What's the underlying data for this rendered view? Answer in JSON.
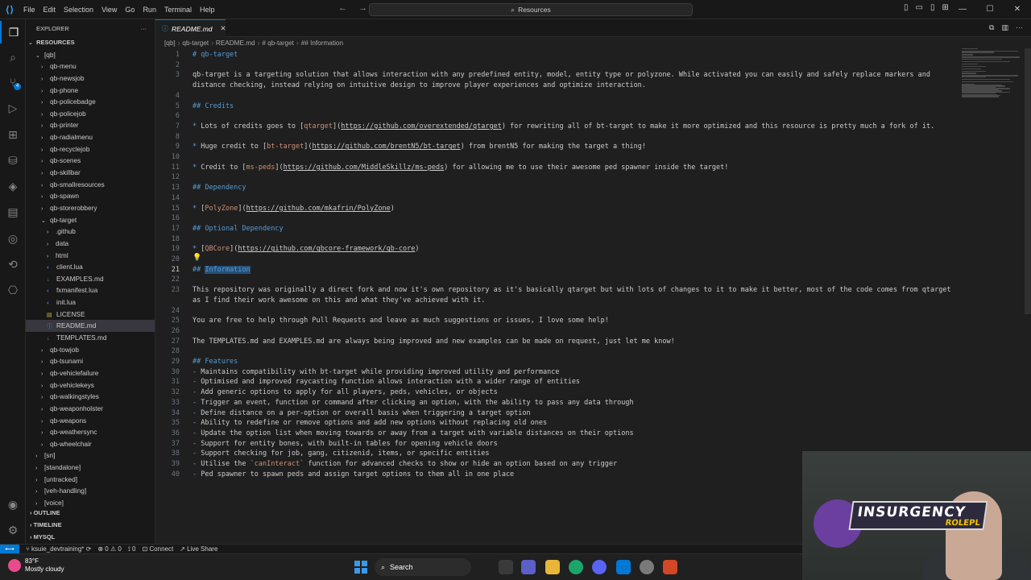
{
  "titlebar": {
    "menu": [
      "File",
      "Edit",
      "Selection",
      "View",
      "Go",
      "Run",
      "Terminal",
      "Help"
    ],
    "search_text": "Resources"
  },
  "sidebar": {
    "title": "EXPLORER",
    "root": "RESOURCES",
    "items": [
      {
        "label": "[qb]",
        "depth": 1,
        "type": "folder-open"
      },
      {
        "label": "qb-menu",
        "depth": 2,
        "type": "folder"
      },
      {
        "label": "qb-newsjob",
        "depth": 2,
        "type": "folder"
      },
      {
        "label": "qb-phone",
        "depth": 2,
        "type": "folder"
      },
      {
        "label": "qb-policebadge",
        "depth": 2,
        "type": "folder"
      },
      {
        "label": "qb-policejob",
        "depth": 2,
        "type": "folder"
      },
      {
        "label": "qb-printer",
        "depth": 2,
        "type": "folder"
      },
      {
        "label": "qb-radialmenu",
        "depth": 2,
        "type": "folder"
      },
      {
        "label": "qb-recyclejob",
        "depth": 2,
        "type": "folder"
      },
      {
        "label": "qb-scenes",
        "depth": 2,
        "type": "folder"
      },
      {
        "label": "qb-skillbar",
        "depth": 2,
        "type": "folder"
      },
      {
        "label": "qb-smallresources",
        "depth": 2,
        "type": "folder"
      },
      {
        "label": "qb-spawn",
        "depth": 2,
        "type": "folder"
      },
      {
        "label": "qb-storerobbery",
        "depth": 2,
        "type": "folder"
      },
      {
        "label": "qb-target",
        "depth": 2,
        "type": "folder-open"
      },
      {
        "label": ".github",
        "depth": 3,
        "type": "folder"
      },
      {
        "label": "data",
        "depth": 3,
        "type": "folder"
      },
      {
        "label": "html",
        "depth": 3,
        "type": "folder"
      },
      {
        "label": "client.lua",
        "depth": 3,
        "type": "lua"
      },
      {
        "label": "EXAMPLES.md",
        "depth": 3,
        "type": "md"
      },
      {
        "label": "fxmanifest.lua",
        "depth": 3,
        "type": "lua"
      },
      {
        "label": "init.lua",
        "depth": 3,
        "type": "lua"
      },
      {
        "label": "LICENSE",
        "depth": 3,
        "type": "license"
      },
      {
        "label": "README.md",
        "depth": 3,
        "type": "info",
        "selected": true
      },
      {
        "label": "TEMPLATES.md",
        "depth": 3,
        "type": "md"
      },
      {
        "label": "qb-towjob",
        "depth": 2,
        "type": "folder"
      },
      {
        "label": "qb-tsunami",
        "depth": 2,
        "type": "folder"
      },
      {
        "label": "qb-vehiclefailure",
        "depth": 2,
        "type": "folder"
      },
      {
        "label": "qb-vehiclekeys",
        "depth": 2,
        "type": "folder"
      },
      {
        "label": "qb-walkingstyles",
        "depth": 2,
        "type": "folder"
      },
      {
        "label": "qb-weaponholster",
        "depth": 2,
        "type": "folder"
      },
      {
        "label": "qb-weapons",
        "depth": 2,
        "type": "folder"
      },
      {
        "label": "qb-weathersync",
        "depth": 2,
        "type": "folder"
      },
      {
        "label": "qb-wheelchair",
        "depth": 2,
        "type": "folder"
      },
      {
        "label": "[sn]",
        "depth": 1,
        "type": "folder"
      },
      {
        "label": "[standalone]",
        "depth": 1,
        "type": "folder"
      },
      {
        "label": "[untracked]",
        "depth": 1,
        "type": "folder"
      },
      {
        "label": "[veh-handling]",
        "depth": 1,
        "type": "folder"
      },
      {
        "label": "[voice]",
        "depth": 1,
        "type": "folder"
      }
    ],
    "sections": [
      "OUTLINE",
      "TIMELINE",
      "MYSQL"
    ]
  },
  "tab": {
    "label": "README.md"
  },
  "breadcrumb": [
    "[qb]",
    "qb-target",
    "README.md",
    "# qb-target",
    "## Information"
  ],
  "lines": [
    {
      "n": "1",
      "parts": [
        [
          "h",
          "# qb-target"
        ]
      ]
    },
    {
      "n": "2",
      "parts": []
    },
    {
      "n": "3",
      "parts": [
        [
          "t",
          "qb-target is a targeting solution that allows interaction with any predefined entity, model, entity type or polyzone. While activated you can easily and safely replace markers and"
        ]
      ]
    },
    {
      "n": "",
      "parts": [
        [
          "t",
          "distance checking, instead relying on intuitive design to improve player experiences and optimize interaction."
        ]
      ]
    },
    {
      "n": "4",
      "parts": []
    },
    {
      "n": "5",
      "parts": [
        [
          "h",
          "## Credits"
        ]
      ]
    },
    {
      "n": "6",
      "parts": []
    },
    {
      "n": "7",
      "parts": [
        [
          "b",
          "* "
        ],
        [
          "t",
          "Lots of credits goes to "
        ],
        [
          "t",
          "["
        ],
        [
          "l",
          "qtarget"
        ],
        [
          "t",
          "]("
        ],
        [
          "u",
          "https://github.com/overextended/qtarget"
        ],
        [
          "t",
          ") for rewriting all of bt-target to make it more optimized and this resource is pretty much a fork of it."
        ]
      ]
    },
    {
      "n": "8",
      "parts": []
    },
    {
      "n": "9",
      "parts": [
        [
          "b",
          "* "
        ],
        [
          "t",
          "Huge credit to ["
        ],
        [
          "l",
          "bt-target"
        ],
        [
          "t",
          "]("
        ],
        [
          "u",
          "https://github.com/brentN5/bt-target"
        ],
        [
          "t",
          ") from brentN5 for making the target a thing!"
        ]
      ]
    },
    {
      "n": "10",
      "parts": []
    },
    {
      "n": "11",
      "parts": [
        [
          "b",
          "* "
        ],
        [
          "t",
          "Credit to ["
        ],
        [
          "l",
          "ms-peds"
        ],
        [
          "t",
          "]("
        ],
        [
          "u",
          "https://github.com/MiddleSkillz/ms-peds"
        ],
        [
          "t",
          ") for allowing me to use their awesome ped spawner inside the target!"
        ]
      ]
    },
    {
      "n": "12",
      "parts": []
    },
    {
      "n": "13",
      "parts": [
        [
          "h",
          "## Dependency"
        ]
      ]
    },
    {
      "n": "14",
      "parts": []
    },
    {
      "n": "15",
      "parts": [
        [
          "b",
          "* "
        ],
        [
          "t",
          "["
        ],
        [
          "l",
          "PolyZone"
        ],
        [
          "t",
          "]("
        ],
        [
          "u",
          "https://github.com/mkafrin/PolyZone"
        ],
        [
          "t",
          ")"
        ]
      ]
    },
    {
      "n": "16",
      "parts": []
    },
    {
      "n": "17",
      "parts": [
        [
          "h",
          "## Optional Dependency"
        ]
      ]
    },
    {
      "n": "18",
      "parts": []
    },
    {
      "n": "19",
      "parts": [
        [
          "b",
          "* "
        ],
        [
          "t",
          "["
        ],
        [
          "l",
          "QBCore"
        ],
        [
          "t",
          "]("
        ],
        [
          "u",
          "https://github.com/qbcore-framework/qb-core"
        ],
        [
          "t",
          ")"
        ]
      ]
    },
    {
      "n": "20",
      "parts": []
    },
    {
      "n": "21",
      "parts": [
        [
          "h",
          "## "
        ],
        [
          "s",
          "Information"
        ]
      ],
      "current": true
    },
    {
      "n": "22",
      "parts": []
    },
    {
      "n": "23",
      "parts": [
        [
          "t",
          "This repository was originally a direct fork and now it's own repository as it's basically qtarget but with lots of changes to it to make it better, most of the code comes from qtarget"
        ]
      ]
    },
    {
      "n": "",
      "parts": [
        [
          "t",
          "as I find their work awesome on this and what they've achieved with it."
        ]
      ]
    },
    {
      "n": "24",
      "parts": []
    },
    {
      "n": "25",
      "parts": [
        [
          "t",
          "You are free to help through Pull Requests and leave as much suggestions or issues, I love some help!"
        ]
      ]
    },
    {
      "n": "26",
      "parts": []
    },
    {
      "n": "27",
      "parts": [
        [
          "t",
          "The TEMPLATES.md and EXAMPLES.md are always being improved and new examples can be made on request, just let me know!"
        ]
      ]
    },
    {
      "n": "28",
      "parts": []
    },
    {
      "n": "29",
      "parts": [
        [
          "h",
          "## Features"
        ]
      ]
    },
    {
      "n": "30",
      "parts": [
        [
          "b",
          "- "
        ],
        [
          "t",
          "Maintains compatibility with bt-target while providing improved utility and performance"
        ]
      ]
    },
    {
      "n": "31",
      "parts": [
        [
          "b",
          "- "
        ],
        [
          "t",
          "Optimised and improved raycasting function allows interaction with a wider range of entities"
        ]
      ]
    },
    {
      "n": "32",
      "parts": [
        [
          "b",
          "- "
        ],
        [
          "t",
          "Add generic options to apply for all players, peds, vehicles, or objects"
        ]
      ]
    },
    {
      "n": "33",
      "parts": [
        [
          "b",
          "- "
        ],
        [
          "t",
          "Trigger an event, function or command after clicking an option, with the ability to pass any data through"
        ]
      ]
    },
    {
      "n": "34",
      "parts": [
        [
          "b",
          "- "
        ],
        [
          "t",
          "Define distance on a per-option or overall basis when triggering a target option"
        ]
      ]
    },
    {
      "n": "35",
      "parts": [
        [
          "b",
          "- "
        ],
        [
          "t",
          "Ability to redefine or remove options and add new options without replacing old ones"
        ]
      ]
    },
    {
      "n": "36",
      "parts": [
        [
          "b",
          "- "
        ],
        [
          "t",
          "Update the option list when moving towards or away from a target with variable distances on their options"
        ]
      ]
    },
    {
      "n": "37",
      "parts": [
        [
          "b",
          "- "
        ],
        [
          "t",
          "Support for entity bones, with built-in tables for opening vehicle doors"
        ]
      ]
    },
    {
      "n": "38",
      "parts": [
        [
          "b",
          "- "
        ],
        [
          "t",
          "Support checking for job, gang, citizenid, items, or specific entities"
        ]
      ]
    },
    {
      "n": "39",
      "parts": [
        [
          "b",
          "- "
        ],
        [
          "t",
          "Utilise the "
        ],
        [
          "c",
          "`canInteract`"
        ],
        [
          "t",
          " function for advanced checks to show or hide an option based on any trigger"
        ]
      ]
    },
    {
      "n": "40",
      "parts": [
        [
          "b",
          "- "
        ],
        [
          "t",
          "Ped spawner to spawn peds and assign target options to them all in one place"
        ]
      ]
    }
  ],
  "statusbar": {
    "branch": "ksuie_devtraining*",
    "errors": "0",
    "warnings": "0",
    "ports": "0",
    "connect": "Connect",
    "liveshare": "Live Share"
  },
  "taskbar": {
    "temperature": "83°F",
    "weather": "Mostly cloudy",
    "search": "Search"
  },
  "webcam": {
    "logo_line1": "INSURGENCY",
    "logo_line2": "ROLEPL"
  },
  "colors": {
    "accent": "#0078d4",
    "heading": "#569cd6",
    "link_text": "#ce9178",
    "selection": "#264f78"
  }
}
